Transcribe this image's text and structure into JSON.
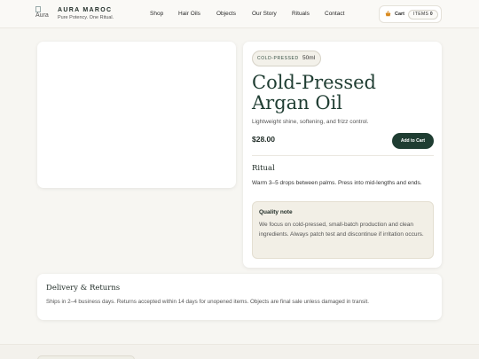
{
  "header": {
    "logo_alt": "Aura",
    "brand_name": "AURA MAROC",
    "brand_tagline": "Pure Potency. One Ritual.",
    "nav": [
      "Shop",
      "Hair Oils",
      "Objects",
      "Our Story",
      "Rituals",
      "Contact"
    ],
    "cart": {
      "icon": "basket-icon",
      "label": "Cart",
      "items_label": "ITEMS",
      "count": "0"
    }
  },
  "product": {
    "badge": "COLD-PRESSED",
    "size": "50ml",
    "title": "Cold-Pressed Argan Oil",
    "subtitle": "Lightweight shine, softening, and frizz control.",
    "price": "$28.00",
    "add_to_cart": "Add to Cart",
    "ritual_heading": "Ritual",
    "ritual_text": "Warm 3–5 drops between palms. Press into mid-lengths and ends.",
    "quality_heading": "Quality note",
    "quality_text": "We focus on cold-pressed, small-batch production and clean ingredients. Always patch test and discontinue if irritation occurs."
  },
  "delivery": {
    "heading": "Delivery & Returns",
    "text": "Ships in 2–4 business days. Returns accepted within 14 days for unopened items. Objects are final sale unless damaged in transit."
  },
  "colors": {
    "accent": "#1f3d32",
    "background": "#f7f6f2",
    "quality_bg": "#f2efe6"
  }
}
